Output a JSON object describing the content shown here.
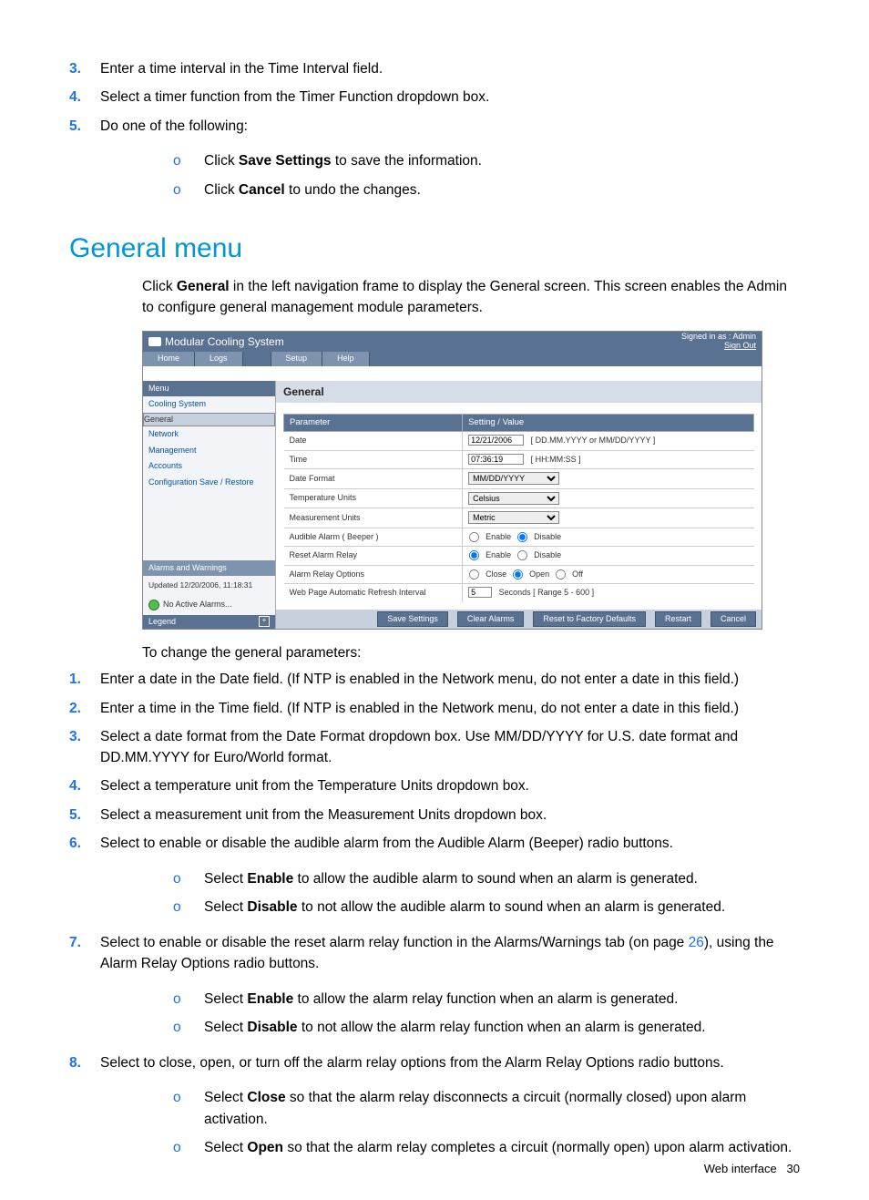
{
  "top_list": {
    "item3": "Enter a time interval in the Time Interval field.",
    "item4": "Select a timer function from the Timer Function dropdown box.",
    "item5": "Do one of the following:",
    "sub5a_pre": "Click ",
    "sub5a_b": "Save Settings",
    "sub5a_post": " to save the information.",
    "sub5b_pre": "Click ",
    "sub5b_b": "Cancel",
    "sub5b_post": " to undo the changes."
  },
  "heading": "General menu",
  "intro_pre": "Click ",
  "intro_b": "General",
  "intro_post": " in the left navigation frame to display the General screen. This screen enables the Admin to configure general management module parameters.",
  "shot": {
    "title": "Modular Cooling System",
    "signed": "Signed in as : Admin",
    "signout": "Sign Out",
    "tabs": [
      "Home",
      "Logs",
      "Setup",
      "Help"
    ],
    "menu_head": "Menu",
    "nav": [
      "Cooling System",
      "General",
      "Network",
      "Management",
      "Accounts",
      "Configuration Save / Restore"
    ],
    "alarms_head": "Alarms and Warnings",
    "updated": "Updated 12/20/2006, 11:18:31",
    "no_alarms": "No Active Alarms...",
    "legend": "Legend",
    "pagetitle": "General",
    "th1": "Parameter",
    "th2": "Setting / Value",
    "rows": {
      "date_lbl": "Date",
      "date_val": "12/21/2006",
      "date_hint": "[ DD.MM.YYYY or MM/DD/YYYY ]",
      "time_lbl": "Time",
      "time_val": "07:36:19",
      "time_hint": "[ HH:MM:SS ]",
      "fmt_lbl": "Date Format",
      "fmt_val": "MM/DD/YYYY",
      "tunit_lbl": "Temperature Units",
      "tunit_val": "Celsius",
      "munit_lbl": "Measurement Units",
      "munit_val": "Metric",
      "beep_lbl": "Audible Alarm ( Beeper )",
      "beep_en": "Enable",
      "beep_dis": "Disable",
      "reset_lbl": "Reset Alarm Relay",
      "reset_en": "Enable",
      "reset_dis": "Disable",
      "relay_lbl": "Alarm Relay Options",
      "relay_close": "Close",
      "relay_open": "Open",
      "relay_off": "Off",
      "refresh_lbl": "Web Page Automatic Refresh Interval",
      "refresh_val": "5",
      "refresh_hint": "Seconds  [ Range 5 - 600 ]"
    },
    "buttons": {
      "save": "Save Settings",
      "clear": "Clear Alarms",
      "reset": "Reset to Factory Defaults",
      "restart": "Restart",
      "cancel": "Cancel"
    }
  },
  "after_shot": "To change the general parameters:",
  "steps": {
    "s1": "Enter a date in the Date field. (If NTP is enabled in the Network menu, do not enter a date in this field.)",
    "s2": "Enter a time in the Time field. (If NTP is enabled in the Network menu, do not enter a date in this field.)",
    "s3": "Select a date format from the Date Format dropdown box. Use MM/DD/YYYY for U.S. date format and DD.MM.YYYY for Euro/World format.",
    "s4": "Select a temperature unit from the Temperature Units dropdown box.",
    "s5": "Select a measurement unit from the Measurement Units dropdown box.",
    "s6": "Select to enable or disable the audible alarm from the Audible Alarm (Beeper) radio buttons.",
    "s6a_pre": "Select ",
    "s6a_b": "Enable",
    "s6a_post": " to allow the audible alarm to sound when an alarm is generated.",
    "s6b_pre": "Select ",
    "s6b_b": "Disable",
    "s6b_post": " to not allow the audible alarm to sound when an alarm is generated.",
    "s7_pre": "Select to enable or disable the reset alarm relay function in the Alarms/Warnings tab (on page ",
    "s7_link": "26",
    "s7_post": "), using the Alarm Relay Options radio buttons.",
    "s7a_pre": "Select ",
    "s7a_b": "Enable",
    "s7a_post": " to allow the alarm relay function when an alarm is generated.",
    "s7b_pre": "Select ",
    "s7b_b": "Disable",
    "s7b_post": " to not allow the alarm relay function when an alarm is generated.",
    "s8": "Select to close, open, or turn off the alarm relay options from the Alarm Relay Options radio buttons.",
    "s8a_pre": "Select ",
    "s8a_b": "Close",
    "s8a_post": " so that the alarm relay disconnects a circuit (normally closed) upon alarm activation.",
    "s8b_pre": "Select ",
    "s8b_b": "Open",
    "s8b_post": " so that the alarm relay completes a circuit (normally open) upon alarm activation."
  },
  "footer_label": "Web interface",
  "footer_page": "30"
}
